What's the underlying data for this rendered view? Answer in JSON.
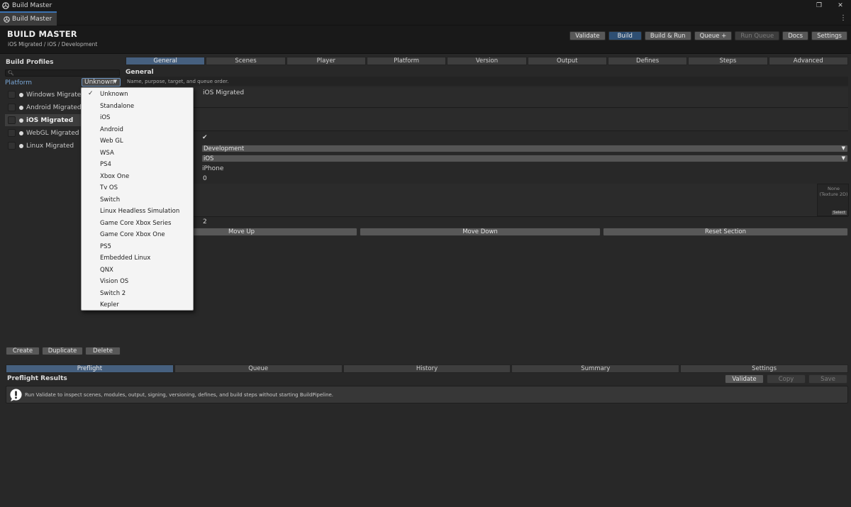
{
  "window": {
    "title": "Build Master",
    "tab_title": "Build Master",
    "controls": {
      "restore": "❐",
      "close": "✕"
    }
  },
  "header": {
    "title": "BUILD MASTER",
    "breadcrumb": "iOS Migrated  /  iOS  /  Development",
    "buttons": {
      "validate": "Validate",
      "build": "Build",
      "build_run": "Build & Run",
      "queue": "Queue +",
      "run_queue": "Run Queue",
      "docs": "Docs",
      "settings": "Settings"
    }
  },
  "left": {
    "title": "Build Profiles",
    "search_icon": "search-icon",
    "platform_label": "Platform",
    "platform_value": "Unknown",
    "profiles": [
      "Windows Migrated",
      "Android Migrated",
      "iOS Migrated",
      "WebGL Migrated",
      "Linux Migrated"
    ],
    "selected_profile": "iOS Migrated",
    "buttons": {
      "create": "Create",
      "duplicate": "Duplicate",
      "delete": "Delete"
    }
  },
  "main": {
    "tabs": [
      "General",
      "Scenes",
      "Player",
      "Platform",
      "Version",
      "Output",
      "Defines",
      "Steps",
      "Advanced"
    ],
    "active_tab": "General",
    "section_title": "General",
    "section_subtitle": "Name, purpose, target, and queue order.",
    "fields": {
      "name": "iOS Migrated",
      "check": "✔",
      "configuration": "Development",
      "target": "iOS",
      "device": "iPhone",
      "zero_value": "0",
      "texture_none": "None",
      "texture_type": "(Texture 2D)",
      "texture_select": "Select",
      "queue_order": "2"
    },
    "buttons": {
      "move_up": "Move Up",
      "move_down": "Move Down",
      "reset_section": "Reset Section"
    }
  },
  "bottom": {
    "tabs": [
      "Preflight",
      "Queue",
      "History",
      "Summary",
      "Settings"
    ],
    "active_tab": "Preflight",
    "results_title": "Preflight Results",
    "buttons": {
      "validate": "Validate",
      "copy": "Copy",
      "save": "Save"
    },
    "message": "Run Validate to inspect scenes, modules, output, signing, versioning, defines, and build steps without starting BuildPipeline."
  },
  "platform_dropdown": {
    "selected": "Unknown",
    "options": [
      "Unknown",
      "Standalone",
      "iOS",
      "Android",
      "Web GL",
      "WSA",
      "PS4",
      "Xbox One",
      "Tv OS",
      "Switch",
      "Linux Headless Simulation",
      "Game Core Xbox Series",
      "Game Core Xbox One",
      "PS5",
      "Embedded Linux",
      "QNX",
      "Vision OS",
      "Switch 2",
      "Kepler"
    ]
  },
  "colors": {
    "accent": "#46607f",
    "primary_button": "#2e4f73",
    "background": "#282828",
    "popup": "#f4f4f4"
  }
}
